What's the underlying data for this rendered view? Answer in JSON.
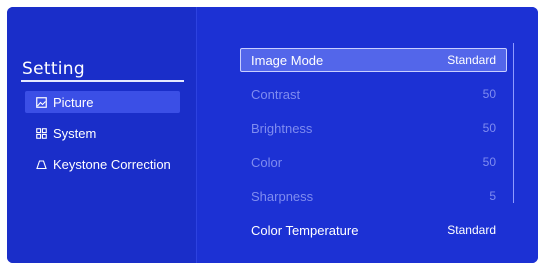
{
  "sidebar": {
    "title": "Setting",
    "items": [
      {
        "label": "Picture",
        "icon": "picture-icon",
        "active": true
      },
      {
        "label": "System",
        "icon": "grid-icon",
        "active": false
      },
      {
        "label": "Keystone Correction",
        "icon": "trapezoid-icon",
        "active": false
      }
    ]
  },
  "settings": [
    {
      "label": "Image Mode",
      "value": "Standard",
      "state": "selected"
    },
    {
      "label": "Contrast",
      "value": "50",
      "state": "dim"
    },
    {
      "label": "Brightness",
      "value": "50",
      "state": "dim"
    },
    {
      "label": "Color",
      "value": "50",
      "state": "dim"
    },
    {
      "label": "Sharpness",
      "value": "5",
      "state": "dim"
    },
    {
      "label": "Color Temperature",
      "value": "Standard",
      "state": "normal"
    }
  ],
  "colors": {
    "background": "#1c31d4",
    "sidebar": "#1a2ec9",
    "selected_row": "#5366ea",
    "dim_text": "#7f8cf0"
  }
}
